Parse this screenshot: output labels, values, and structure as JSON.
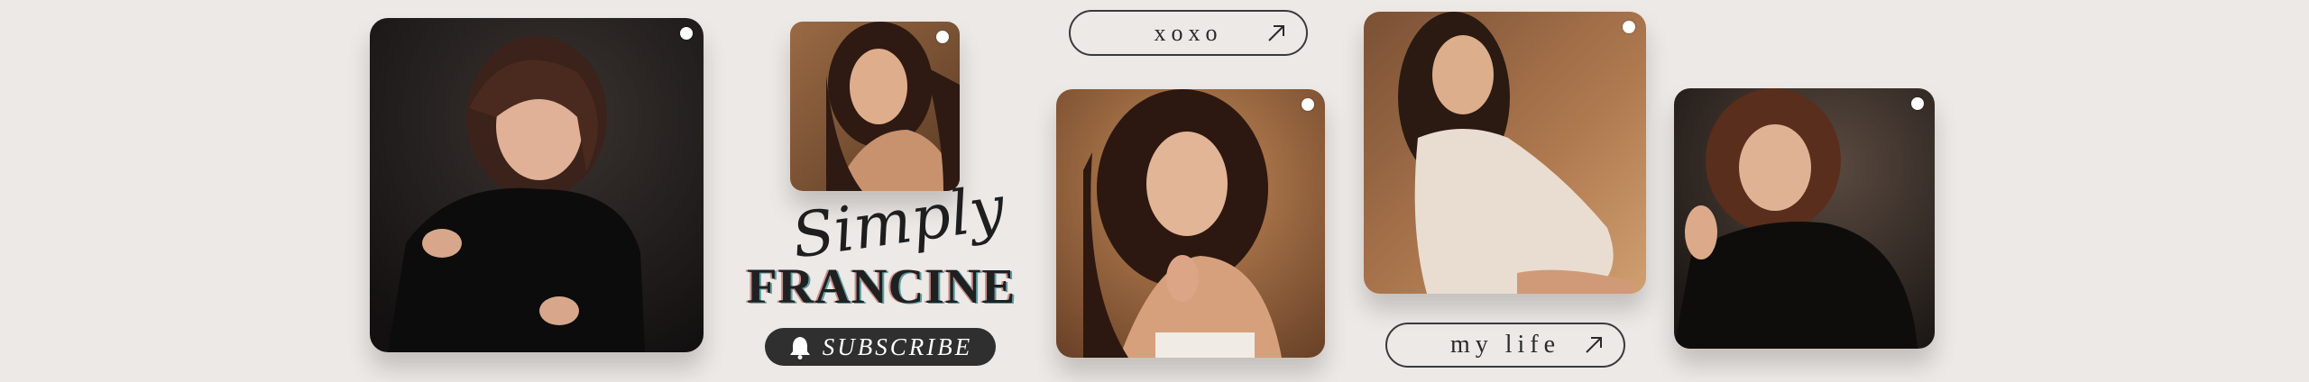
{
  "brand": {
    "script": "Simply",
    "name": "FRANCINE"
  },
  "buttons": {
    "xoxo_label": "xoxo",
    "mylife_label": "my life",
    "subscribe_label": "SUBSCRIBE"
  },
  "icons": {
    "arrow": "arrow-up-right-icon",
    "bell": "bell-icon",
    "photo_marker": "white-dot-icon"
  },
  "colors": {
    "background": "#ede9e6",
    "subscribe_bg": "#2f2f2f",
    "text": "#2a2a2a"
  }
}
